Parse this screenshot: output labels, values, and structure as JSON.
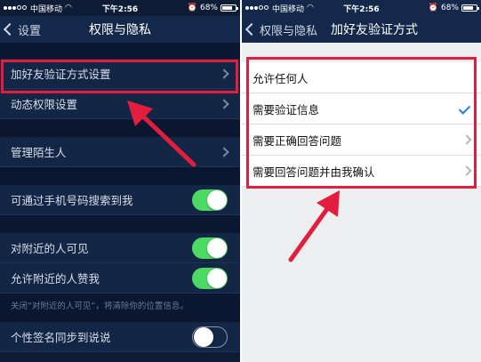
{
  "left": {
    "status": {
      "carrier": "中国移动",
      "time": "下午2:56",
      "battery": "68%",
      "battery_level": 0.68
    },
    "nav": {
      "back_label": "设置",
      "title": "权限与隐私"
    },
    "rows": {
      "friend_verify": "加好友验证方式设置",
      "dynamic_perm": "动态权限设置",
      "manage_strangers": "管理陌生人",
      "search_by_phone": "可通过手机号码搜索到我",
      "visible_nearby": "对附近的人可见",
      "allow_nearby_like": "允许附近的人赞我",
      "hint": "关闭“对附近的人可见”，将清除你的位置信息。",
      "signature_sync": "个性签名同步到说说"
    },
    "toggles": {
      "search_by_phone": true,
      "visible_nearby": true,
      "allow_nearby_like": true,
      "signature_sync": false
    }
  },
  "right": {
    "status": {
      "carrier": "中国移动",
      "time": "下午2:56",
      "battery": "68%",
      "battery_level": 0.68
    },
    "nav": {
      "back_label": "权限与隐私",
      "title": "加好友验证方式"
    },
    "options": [
      {
        "label": "允许任何人",
        "accessory": "none"
      },
      {
        "label": "需要验证信息",
        "accessory": "check"
      },
      {
        "label": "需要正确回答问题",
        "accessory": "chevron"
      },
      {
        "label": "需要回答问题并由我确认",
        "accessory": "chevron"
      }
    ]
  },
  "colors": {
    "highlight": "#e21d3d",
    "toggle_on": "#4cd964",
    "check": "#1e7ce6"
  }
}
